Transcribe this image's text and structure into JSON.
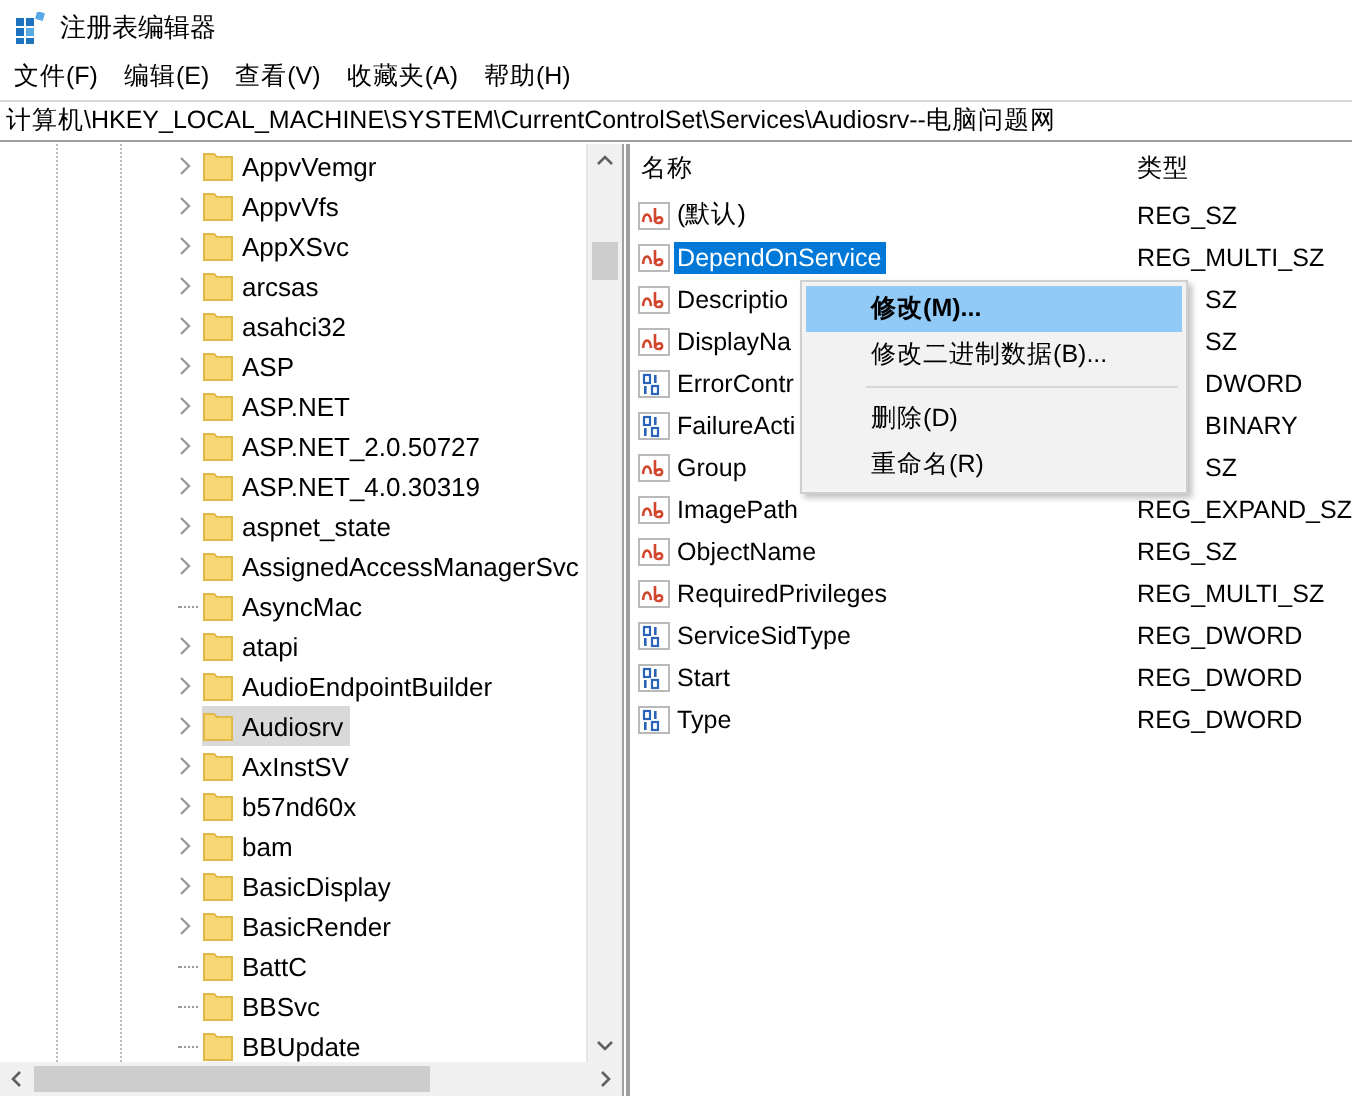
{
  "window": {
    "title": "注册表编辑器"
  },
  "menu_bar": [
    "文件(F)",
    "编辑(E)",
    "查看(V)",
    "收藏夹(A)",
    "帮助(H)"
  ],
  "address": "计算机\\HKEY_LOCAL_MACHINE\\SYSTEM\\CurrentControlSet\\Services\\Audiosrv--电脑问题网",
  "tree": {
    "items": [
      {
        "label": "AppvVemgr",
        "expandable": true,
        "selected": false
      },
      {
        "label": "AppvVfs",
        "expandable": true,
        "selected": false
      },
      {
        "label": "AppXSvc",
        "expandable": true,
        "selected": false
      },
      {
        "label": "arcsas",
        "expandable": true,
        "selected": false
      },
      {
        "label": "asahci32",
        "expandable": true,
        "selected": false
      },
      {
        "label": "ASP",
        "expandable": true,
        "selected": false
      },
      {
        "label": "ASP.NET",
        "expandable": true,
        "selected": false
      },
      {
        "label": "ASP.NET_2.0.50727",
        "expandable": true,
        "selected": false
      },
      {
        "label": "ASP.NET_4.0.30319",
        "expandable": true,
        "selected": false
      },
      {
        "label": "aspnet_state",
        "expandable": true,
        "selected": false
      },
      {
        "label": "AssignedAccessManagerSvc",
        "expandable": true,
        "selected": false
      },
      {
        "label": "AsyncMac",
        "expandable": false,
        "selected": false
      },
      {
        "label": "atapi",
        "expandable": true,
        "selected": false
      },
      {
        "label": "AudioEndpointBuilder",
        "expandable": true,
        "selected": false
      },
      {
        "label": "Audiosrv",
        "expandable": true,
        "selected": true
      },
      {
        "label": "AxInstSV",
        "expandable": true,
        "selected": false
      },
      {
        "label": "b57nd60x",
        "expandable": true,
        "selected": false
      },
      {
        "label": "bam",
        "expandable": true,
        "selected": false
      },
      {
        "label": "BasicDisplay",
        "expandable": true,
        "selected": false
      },
      {
        "label": "BasicRender",
        "expandable": true,
        "selected": false
      },
      {
        "label": "BattC",
        "expandable": false,
        "selected": false
      },
      {
        "label": "BBSvc",
        "expandable": false,
        "selected": false
      },
      {
        "label": "BBUpdate",
        "expandable": false,
        "selected": false
      }
    ]
  },
  "values": {
    "columns": [
      "名称",
      "类型"
    ],
    "rows": [
      {
        "name": "(默认)",
        "type": "REG_SZ",
        "kind": "string",
        "selected": false,
        "covered": false
      },
      {
        "name": "DependOnService",
        "type": "REG_MULTI_SZ",
        "kind": "string",
        "selected": true,
        "covered": false
      },
      {
        "name": "Descriptio",
        "type": "SZ",
        "kind": "string",
        "selected": false,
        "covered": true
      },
      {
        "name": "DisplayNa",
        "type": "SZ",
        "kind": "string",
        "selected": false,
        "covered": true
      },
      {
        "name": "ErrorContr",
        "type": "DWORD",
        "kind": "binary",
        "selected": false,
        "covered": true
      },
      {
        "name": "FailureActi",
        "type": "BINARY",
        "kind": "binary",
        "selected": false,
        "covered": true
      },
      {
        "name": "Group",
        "type": "SZ",
        "kind": "string",
        "selected": false,
        "covered": true
      },
      {
        "name": "ImagePath",
        "type": "REG_EXPAND_SZ",
        "kind": "string",
        "selected": false,
        "covered": false
      },
      {
        "name": "ObjectName",
        "type": "REG_SZ",
        "kind": "string",
        "selected": false,
        "covered": false
      },
      {
        "name": "RequiredPrivileges",
        "type": "REG_MULTI_SZ",
        "kind": "string",
        "selected": false,
        "covered": false
      },
      {
        "name": "ServiceSidType",
        "type": "REG_DWORD",
        "kind": "binary",
        "selected": false,
        "covered": false
      },
      {
        "name": "Start",
        "type": "REG_DWORD",
        "kind": "binary",
        "selected": false,
        "covered": false
      },
      {
        "name": "Type",
        "type": "REG_DWORD",
        "kind": "binary",
        "selected": false,
        "covered": false
      }
    ]
  },
  "context_menu": {
    "groups": [
      [
        {
          "label": "修改(M)...",
          "default": true,
          "selected": true
        },
        {
          "label": "修改二进制数据(B)...",
          "default": false,
          "selected": false
        }
      ],
      [
        {
          "label": "删除(D)",
          "default": false,
          "selected": false
        },
        {
          "label": "重命名(R)",
          "default": false,
          "selected": false
        }
      ]
    ]
  }
}
